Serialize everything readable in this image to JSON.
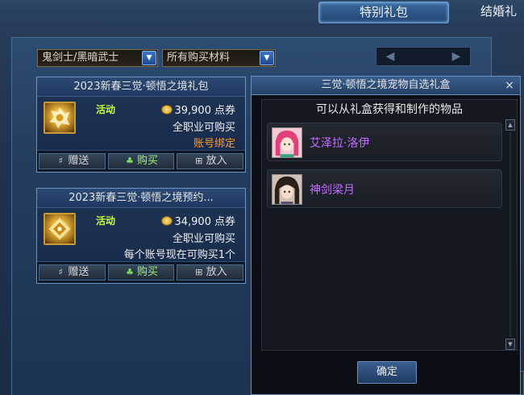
{
  "tabs": {
    "special_gift": "特别礼包",
    "wedding": "结婚礼"
  },
  "filters": {
    "job": {
      "value": "鬼剑士/黑暗武士",
      "arrow": "chevron-down-icon"
    },
    "material": {
      "value": "所有购买材料",
      "arrow": "chevron-down-icon"
    }
  },
  "pager": {
    "prev": "◀",
    "next": "▶"
  },
  "products": [
    {
      "title": "2023新春三觉·顿悟之境礼包",
      "badge": "活动",
      "price": "39,900",
      "currency": "点券",
      "line2": "全职业可购买",
      "line3": "账号绑定",
      "actions": {
        "gift": "赠送",
        "buy": "购买",
        "cart": "放入"
      }
    },
    {
      "title": "2023新春三觉·顿悟之境预约...",
      "badge": "活动",
      "price": "34,900",
      "currency": "点券",
      "line2": "全职业可购买",
      "line3": "每个账号现在可购买1个",
      "actions": {
        "gift": "赠送",
        "buy": "购买",
        "cart": "放入"
      }
    }
  ],
  "popup": {
    "title": "三觉·顿悟之境宠物自选礼盒",
    "close": "×",
    "subtitle": "可以从礼盒获得和制作的物品",
    "rewards": [
      {
        "name": "艾泽拉·洛伊"
      },
      {
        "name": "神剑梁月"
      }
    ],
    "confirm": "确定"
  },
  "colors": {
    "reward_name": "#c46bff",
    "badge": "#c6ff3a",
    "bound": "#ff9a2a"
  }
}
